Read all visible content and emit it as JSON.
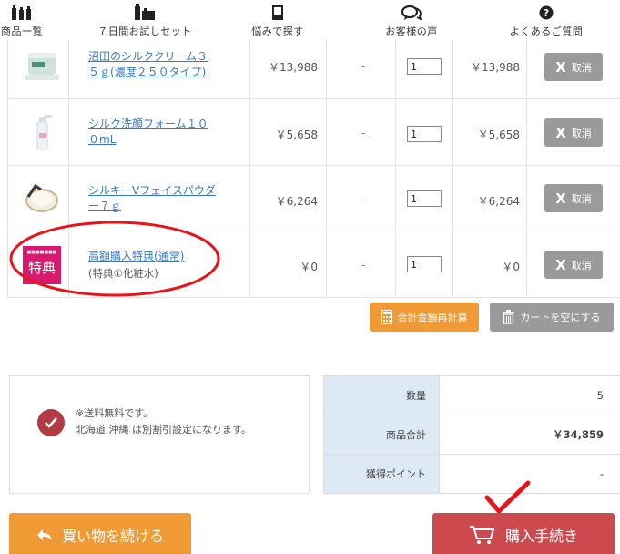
{
  "nav": {
    "items": [
      {
        "label": "商品一覧",
        "icon": "bottles-icon"
      },
      {
        "label": "７日間お試しセット",
        "icon": "trial-set-icon"
      },
      {
        "label": "悩みで探す",
        "icon": "book-icon"
      },
      {
        "label": "お客様の声",
        "icon": "speech-bubbles-icon"
      },
      {
        "label": "よくあるご質問",
        "icon": "question-icon"
      }
    ]
  },
  "cart": {
    "rows": [
      {
        "name": "沼田のシルククリーム３５ｇ(濃度２５０タイプ)",
        "note": "",
        "price": "￥13,988",
        "dash": "-",
        "qty": "1",
        "subtotal": "￥13,988",
        "delete_label": "取消",
        "thumb": "cream-jar"
      },
      {
        "name": "シルク洗顔フォーム１００mL",
        "note": "",
        "price": "￥5,658",
        "dash": "-",
        "qty": "1",
        "subtotal": "￥5,658",
        "delete_label": "取消",
        "thumb": "foam-bottle"
      },
      {
        "name": "シルキーVフェイスパウダー７ｇ",
        "note": "",
        "price": "￥6,264",
        "dash": "-",
        "qty": "1",
        "subtotal": "￥6,264",
        "delete_label": "取消",
        "thumb": "powder-compact"
      },
      {
        "name": "高額購入特典(通常)",
        "note": "(特典①化粧水)",
        "price": "￥0",
        "dash": "-",
        "qty": "1",
        "subtotal": "￥0",
        "delete_label": "取消",
        "thumb": "bonus-card",
        "thumb_text": "特典"
      }
    ],
    "recalc_label": "合計金額再計算",
    "empty_label": "カートを空にする"
  },
  "shipping": {
    "line1": "※送料無料です。",
    "line2": "北海道 沖縄 は別割引設定になります。"
  },
  "summary": {
    "rows": [
      {
        "label": "数量",
        "value": "5"
      },
      {
        "label": "商品合計",
        "value": "￥34,859"
      },
      {
        "label": "獲得ポイント",
        "value": "-"
      }
    ]
  },
  "buttons": {
    "continue": "買い物を続ける",
    "purchase": "購入手続き"
  },
  "colors": {
    "orange": "#ef9a35",
    "gray": "#9a9a9a",
    "red_button": "#cc4a4e",
    "annotation_red": "#e8141a",
    "label_bg": "#dde9f4",
    "link": "#3a7bbf"
  }
}
